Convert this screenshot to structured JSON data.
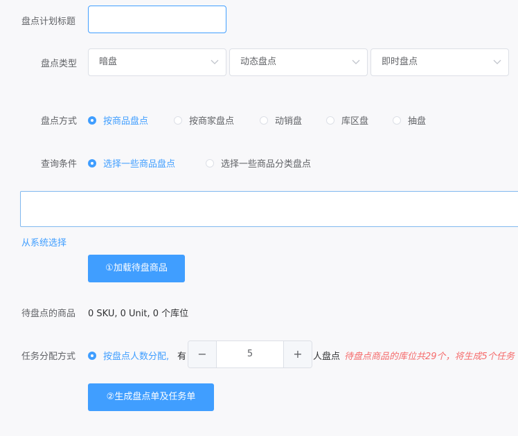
{
  "form": {
    "title_label": "盘点计划标题",
    "title_value": "",
    "type_label": "盘点类型",
    "type_selects": [
      "暗盘",
      "动态盘点",
      "即时盘点"
    ],
    "method_label": "盘点方式",
    "method_options": [
      "按商品盘点",
      "按商家盘点",
      "动销盘",
      "库区盘",
      "抽盘"
    ],
    "method_selected": "按商品盘点",
    "query_label": "查询条件",
    "query_options": [
      "选择一些商品盘点",
      "选择一些商品分类盘点"
    ],
    "query_selected": "选择一些商品盘点",
    "goods_input_value": "",
    "system_select_link": "从系统选择",
    "load_button": "①加载待盘商品",
    "pending_label": "待盘点的商品",
    "pending_summary": "0 SKU,  0 Unit,  0 个库位",
    "assign_label": "任务分配方式",
    "assign_option": "按盘点人数分配,",
    "assign_prefix": "有",
    "assign_count": "5",
    "assign_suffix": "人盘点",
    "assign_warning": "待盘点商品的库位共29个，将生成5个任务",
    "generate_button": "②生成盘点单及任务单"
  },
  "colors": {
    "accent": "#409eff",
    "warning": "#f56c6c",
    "border": "#dcdfe6",
    "background": "#f8f8fa"
  },
  "icons": {
    "select_arrow": "chevron-down-icon",
    "stepper_minus": "minus-icon",
    "stepper_plus": "plus-icon"
  }
}
